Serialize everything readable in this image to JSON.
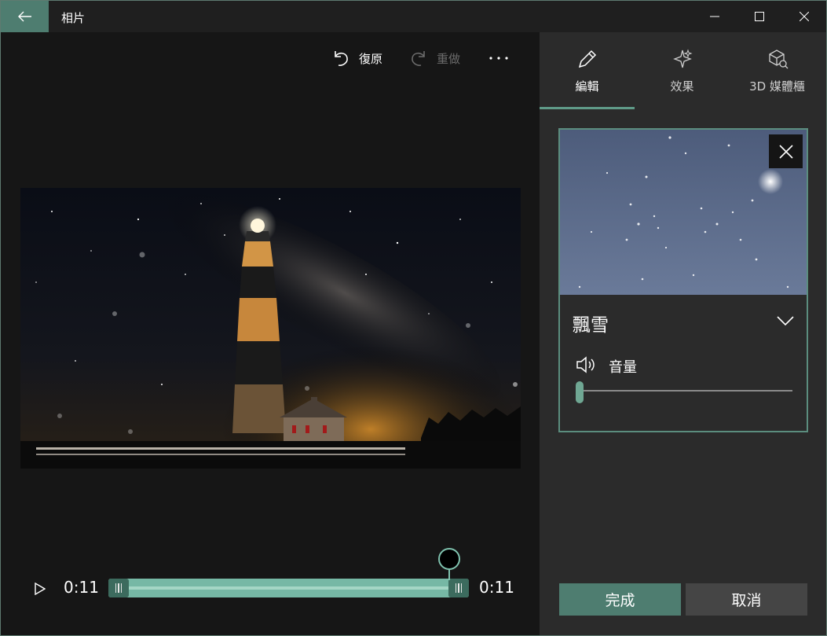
{
  "window": {
    "title": "相片"
  },
  "toolbar": {
    "undo_label": "復原",
    "redo_label": "重做"
  },
  "playback": {
    "current_time": "0:11",
    "end_time": "0:11",
    "progress": 0.94
  },
  "tabs": [
    {
      "label": "編輯",
      "icon": "pencil-icon",
      "active": true
    },
    {
      "label": "效果",
      "icon": "sparkle-icon",
      "active": false
    },
    {
      "label": "3D 媒體櫃",
      "icon": "cube-icon",
      "active": false
    }
  ],
  "effect": {
    "name": "飄雪",
    "volume_label": "音量",
    "volume": 0
  },
  "actions": {
    "done_label": "完成",
    "cancel_label": "取消"
  },
  "colors": {
    "accent": "#4e7d70",
    "accent_light": "#76b8a5",
    "panel_bg": "#2b2b2b",
    "editor_bg": "#161616"
  }
}
